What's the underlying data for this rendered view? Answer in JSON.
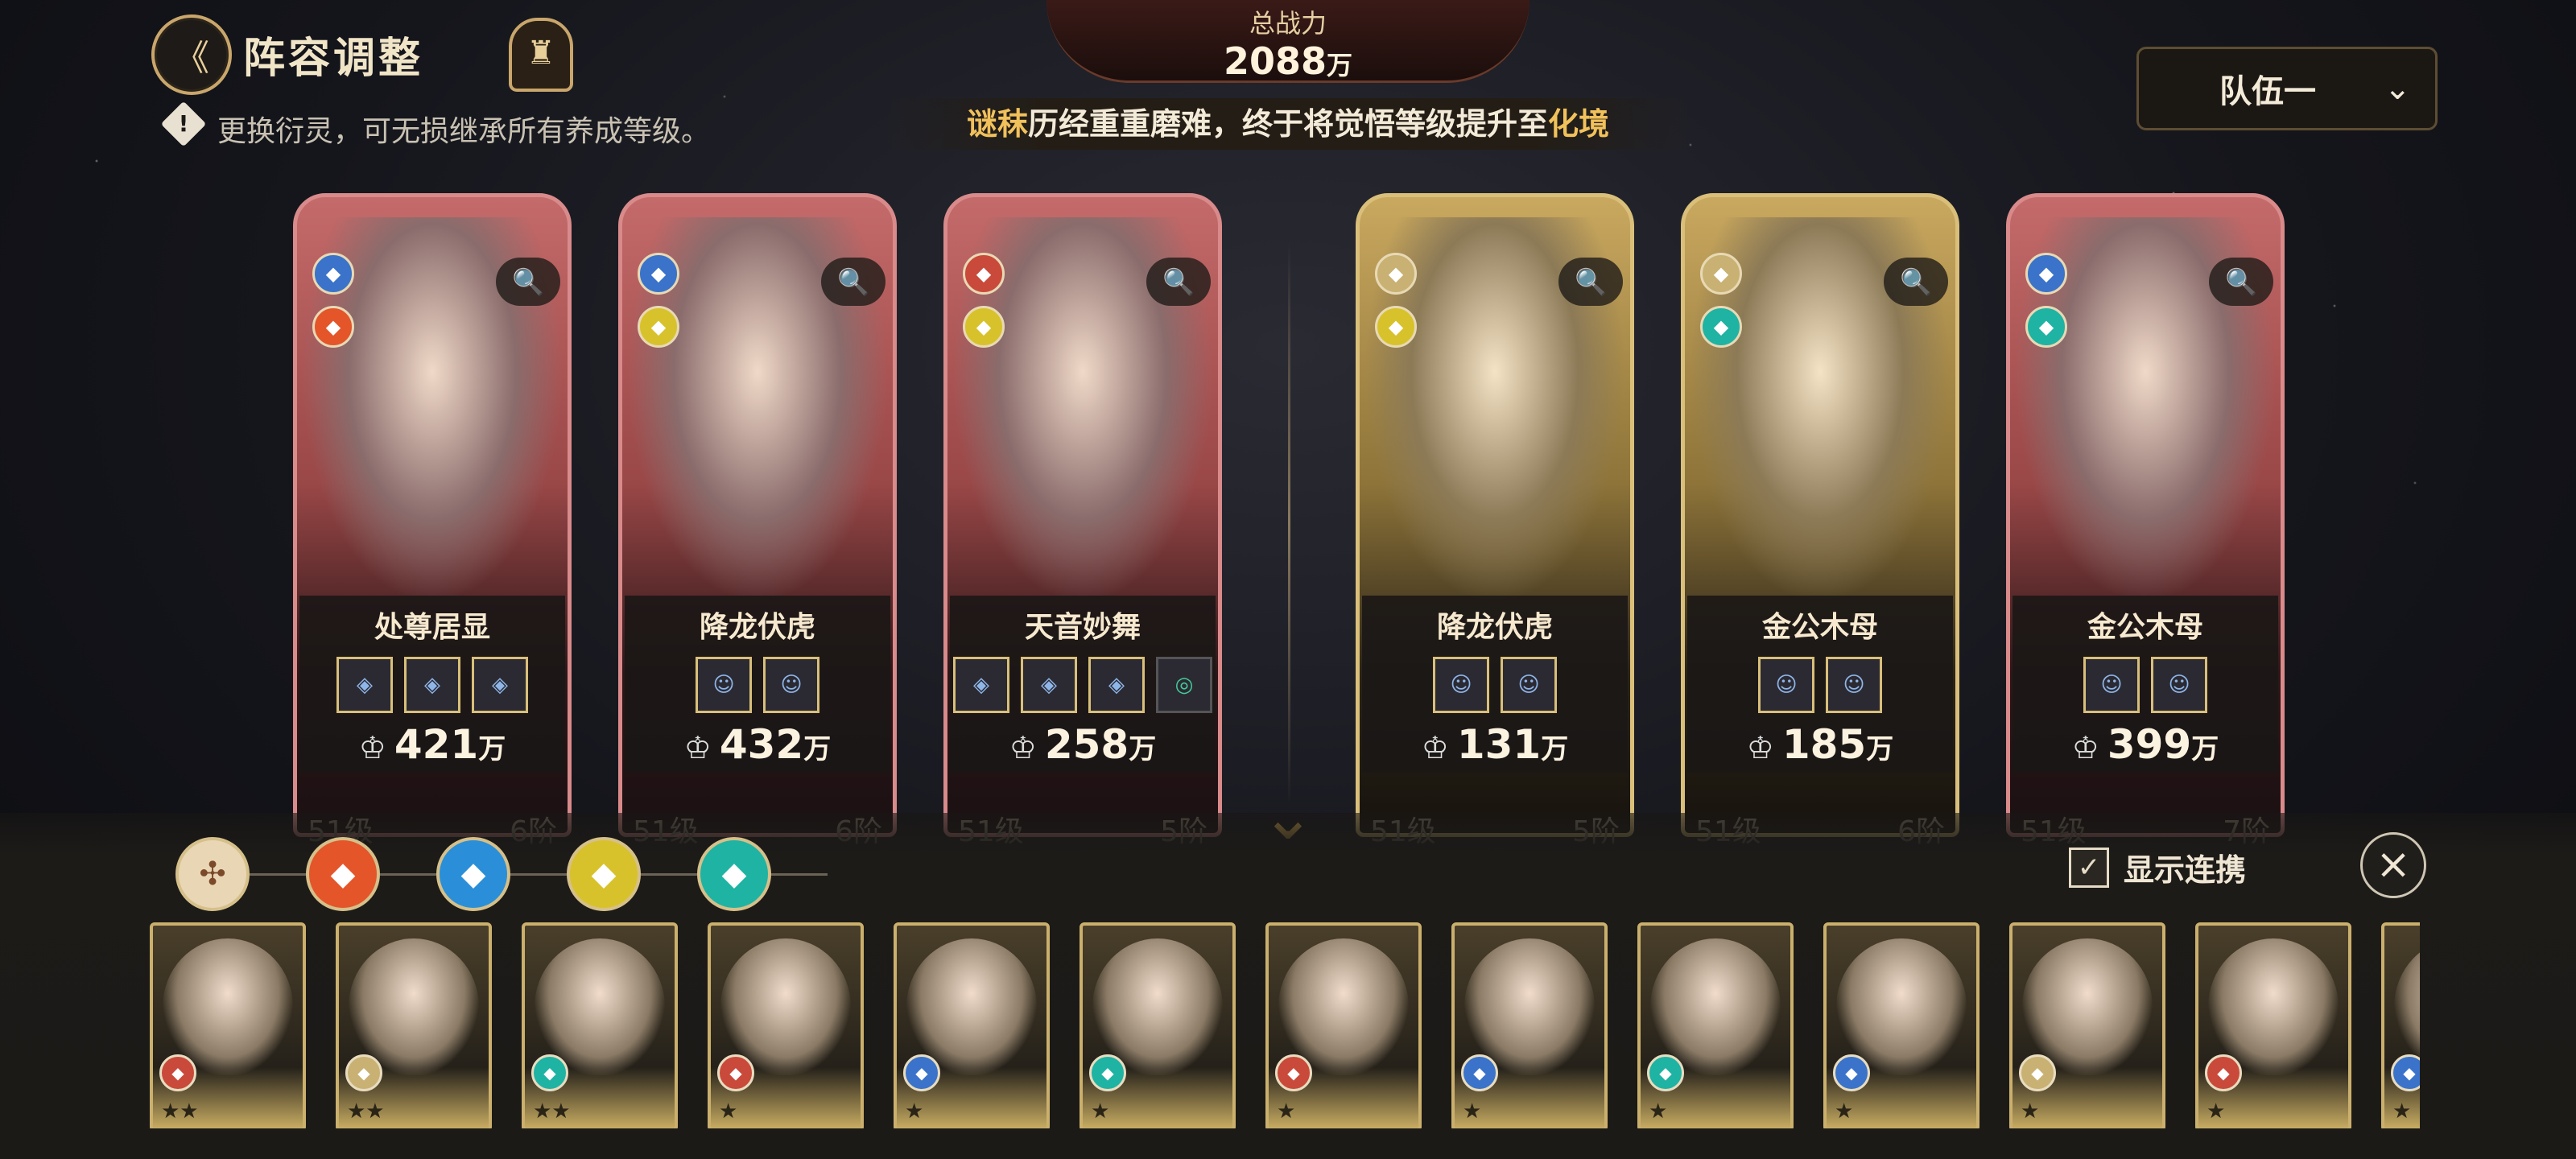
{
  "header": {
    "back_icon": "back-chevron-icon",
    "title": "阵容调整",
    "tip": "更换衍灵，可无损继承所有养成等级。",
    "total_power_label": "总战力",
    "total_power_value": "2088",
    "total_power_unit": "万",
    "banner": {
      "name": "谜秣",
      "middle": "历经重重磨难，终于将觉悟等级提升至",
      "realm": "化境"
    },
    "team_select": {
      "value": "队伍一"
    }
  },
  "cards": [
    {
      "name": "处尊居显",
      "power": "421",
      "unit": "万",
      "level": "51级",
      "stage": "6阶",
      "theme": "red",
      "elements": [
        {
          "color": "#3a73c9",
          "icon": "blade-icon"
        },
        {
          "color": "#e4552a",
          "icon": "fire-icon"
        }
      ],
      "skills": [
        "◈",
        "◈",
        "◈"
      ]
    },
    {
      "name": "降龙伏虎",
      "power": "432",
      "unit": "万",
      "level": "51级",
      "stage": "6阶",
      "theme": "red",
      "elements": [
        {
          "color": "#3a73c9",
          "icon": "blade-icon"
        },
        {
          "color": "#d8c22b",
          "icon": "lotus-icon"
        }
      ],
      "skills": [
        "☺",
        "☺"
      ]
    },
    {
      "name": "天音妙舞",
      "power": "258",
      "unit": "万",
      "level": "51级",
      "stage": "5阶",
      "theme": "red",
      "elements": [
        {
          "color": "#c94a3a",
          "icon": "sword-icon"
        },
        {
          "color": "#d8c22b",
          "icon": "lotus-icon"
        }
      ],
      "skills": [
        "◈",
        "◈",
        "◈",
        "◎"
      ]
    },
    {
      "name": "降龙伏虎",
      "power": "131",
      "unit": "万",
      "level": "51级",
      "stage": "5阶",
      "theme": "gold",
      "elements": [
        {
          "color": "#c9b173",
          "icon": "shield-icon"
        },
        {
          "color": "#d8c22b",
          "icon": "lotus-icon"
        }
      ],
      "skills": [
        "☺",
        "☺"
      ]
    },
    {
      "name": "金公木母",
      "power": "185",
      "unit": "万",
      "level": "51级",
      "stage": "6阶",
      "theme": "gold",
      "elements": [
        {
          "color": "#c9b173",
          "icon": "shield-icon"
        },
        {
          "color": "#1fb3a3",
          "icon": "wind-icon"
        }
      ],
      "skills": [
        "☺",
        "☺"
      ]
    },
    {
      "name": "金公木母",
      "power": "399",
      "unit": "万",
      "level": "51级",
      "stage": "7阶",
      "theme": "red",
      "elements": [
        {
          "color": "#3a73c9",
          "icon": "blade-icon"
        },
        {
          "color": "#1fb3a3",
          "icon": "wind-icon"
        }
      ],
      "skills": [
        "☺",
        "☺"
      ]
    }
  ],
  "filters": [
    {
      "name": "all",
      "color": "#e9d6b5",
      "icon": "all-filter-icon"
    },
    {
      "name": "fire",
      "color": "#e4552a",
      "icon": "fire-icon"
    },
    {
      "name": "water",
      "color": "#2a8fd8",
      "icon": "water-icon"
    },
    {
      "name": "lotus",
      "color": "#d8c22b",
      "icon": "lotus-icon"
    },
    {
      "name": "wind",
      "color": "#1fb3a3",
      "icon": "wind-icon"
    }
  ],
  "show_link": {
    "label": "显示连携",
    "checked": true
  },
  "roster": [
    {
      "icon": "sword-icon",
      "color": "#c94a3a",
      "stars": "★★"
    },
    {
      "icon": "shield-icon",
      "color": "#c9b173",
      "stars": "★★"
    },
    {
      "icon": "wind-icon",
      "color": "#1fb3a3",
      "stars": "★★"
    },
    {
      "icon": "sword-icon",
      "color": "#c94a3a",
      "stars": "★"
    },
    {
      "icon": "blade-icon",
      "color": "#3a73c9",
      "stars": "★"
    },
    {
      "icon": "wind-icon",
      "color": "#1fb3a3",
      "stars": "★"
    },
    {
      "icon": "sword-icon",
      "color": "#c94a3a",
      "stars": "★"
    },
    {
      "icon": "blade-icon",
      "color": "#3a73c9",
      "stars": "★"
    },
    {
      "icon": "wind-icon",
      "color": "#1fb3a3",
      "stars": "★"
    },
    {
      "icon": "blade-icon",
      "color": "#3a73c9",
      "stars": "★"
    },
    {
      "icon": "shield-icon",
      "color": "#c9b173",
      "stars": "★"
    },
    {
      "icon": "sword-icon",
      "color": "#c94a3a",
      "stars": "★"
    },
    {
      "icon": "blade-icon",
      "color": "#3a73c9",
      "stars": "★"
    }
  ]
}
